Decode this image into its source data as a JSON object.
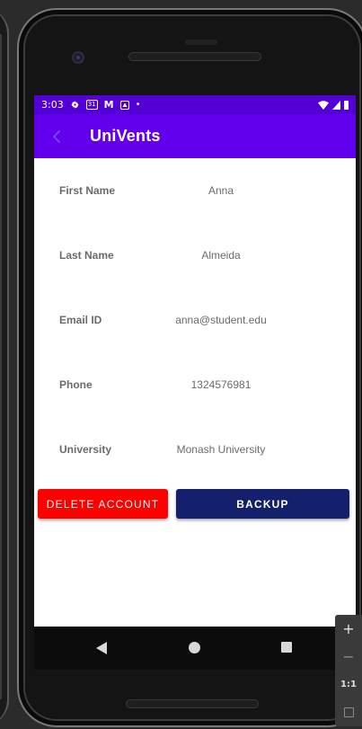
{
  "status_bar": {
    "time": "3:03",
    "icons": [
      "gear-icon",
      "calendar-icon",
      "gmail-icon",
      "notification-icon",
      "dot-icon"
    ],
    "calendar_glyph": "31",
    "mail_glyph": "M",
    "dot_glyph": "•"
  },
  "app_bar": {
    "title": "UniVents"
  },
  "profile": {
    "fields": [
      {
        "label": "First Name",
        "value": "Anna"
      },
      {
        "label": "Last Name",
        "value": "Almeida"
      },
      {
        "label": "Email ID",
        "value": "anna@student.edu"
      },
      {
        "label": "Phone",
        "value": "1324576981"
      },
      {
        "label": "University",
        "value": "Monash University"
      }
    ]
  },
  "actions": {
    "delete_label": "DELETE ACCOUNT",
    "backup_label": "BACKUP"
  },
  "emulator_controls": {
    "zoom_in": "+",
    "zoom_out": "−",
    "actual_size": "1:1"
  },
  "colors": {
    "status_bar": "#5300d6",
    "app_bar": "#6200ee",
    "delete": "#ff0000",
    "backup": "#14206b",
    "text": "#6b6b6b"
  }
}
